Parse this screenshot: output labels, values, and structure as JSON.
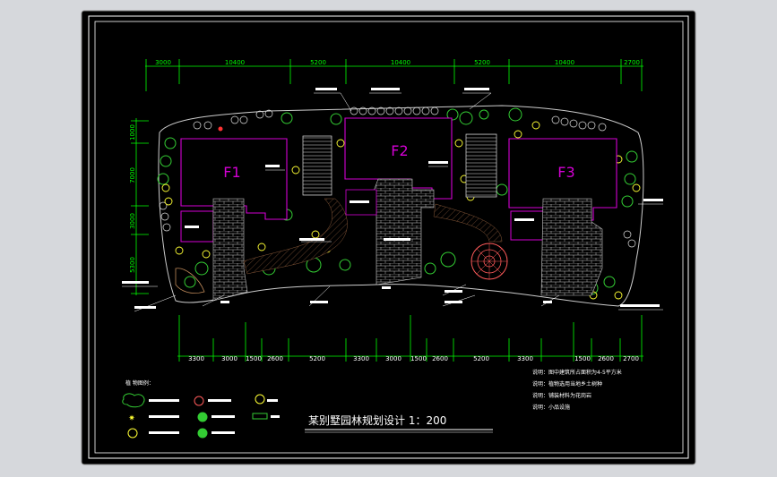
{
  "colors": {
    "background": "#d6d8dc",
    "paper": "#000000",
    "frame": "#ffffff",
    "building_outline": "#d400d4",
    "dimension": "#00ff00",
    "annotation": "#ffffff",
    "paving": "#c8c8c8",
    "plant_yellow": "#ffff33",
    "plant_green": "#33cc33",
    "plant_white": "#e0e0e0",
    "plaza_red": "#ff5a5a"
  },
  "top_dimensions": [
    "3000",
    "10400",
    "5200",
    "10400",
    "5200",
    "10400",
    "2700"
  ],
  "bottom_dimensions": [
    "3300",
    "3000",
    "1500",
    "2600",
    "5200",
    "3300",
    "3000",
    "1500",
    "2600",
    "5200",
    "3300",
    "1500",
    "2600",
    "2700"
  ],
  "left_dimensions": [
    "1000",
    "7000",
    "3000",
    "5300"
  ],
  "buildings": {
    "f1": "F1",
    "f2": "F2",
    "f3": "F3"
  },
  "title": "某别墅园林规划设计 1：200",
  "legend_heading": "植 物图例：",
  "notes": [
    "说明：图中建筑所占面积为4-5平方米",
    "说明：植物选用当地乡土树种",
    "说明：铺装材料为花岗岩",
    "说明：小品设施"
  ],
  "icons": {
    "shrub_cluster": "shrub-cluster-icon",
    "flower": "flower-icon",
    "tree": "tree-icon",
    "evergreen": "evergreen-icon",
    "lawn": "lawn-icon"
  }
}
